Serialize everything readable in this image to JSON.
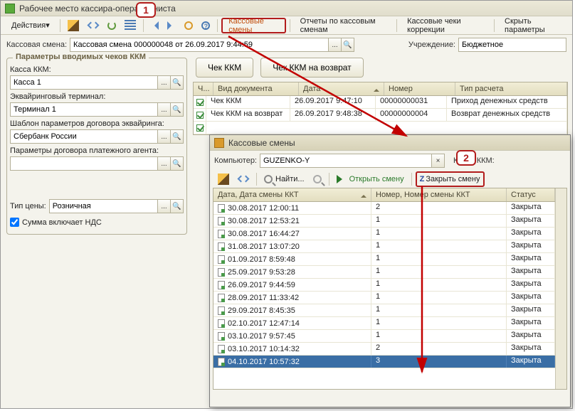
{
  "window": {
    "title": "Рабочее место кассира-операциониста"
  },
  "toolbar": {
    "actions": "Действия",
    "tab_shifts": "Кассовые смены",
    "tab_reports": "Отчеты по кассовым сменам",
    "tab_corrections": "Кассовые чеки коррекции",
    "tab_hide": "Скрыть параметры"
  },
  "shift": {
    "label": "Кассовая смена:",
    "value": "Кассовая смена 000000048 от 26.09.2017 9:44:59",
    "inst_label": "Учреждение:",
    "inst_value": "Бюджетное"
  },
  "group": {
    "legend": "Параметры вводимых чеков ККМ",
    "kassa_label": "Касса ККМ:",
    "kassa_value": "Касса 1",
    "term_label": "Эквайринговый терминал:",
    "term_value": "Терминал 1",
    "tmpl_label": "Шаблон параметров договора эквайринга:",
    "tmpl_value": "Сбербанк России",
    "agent_label": "Параметры договора платежного агента:",
    "agent_value": "",
    "price_label": "Тип цены:",
    "price_value": "Розничная",
    "vat_label": "Сумма включает НДС"
  },
  "buttons": {
    "check": "Чек ККМ",
    "refund": "Чек ККМ на возврат"
  },
  "docs": {
    "headers": {
      "c1": "Ч...",
      "c2": "Вид документа",
      "c3": "Дата",
      "c4": "Номер",
      "c5": "Тип расчета"
    },
    "rows": [
      {
        "kind": "Чек ККМ",
        "date": "26.09.2017 9:47:10",
        "num": "00000000031",
        "type": "Приход денежных средств"
      },
      {
        "kind": "Чек ККМ на возврат",
        "date": "26.09.2017 9:48:38",
        "num": "00000000004",
        "type": "Возврат денежных средств"
      }
    ]
  },
  "popup": {
    "title": "Кассовые смены",
    "comp_label": "Компьютер:",
    "comp_value": "GUZENKO-Y",
    "kassa_label": "Касса ККМ:",
    "find": "Найти...",
    "open": "Открыть смену",
    "close": "Закрыть смену",
    "headers": {
      "c1": "Дата, Дата смены ККТ",
      "c2": "Номер, Номер смены ККТ",
      "c3": "Статус"
    },
    "rows": [
      {
        "date": "30.08.2017 12:00:11",
        "num": "2",
        "status": "Закрыта"
      },
      {
        "date": "30.08.2017 12:53:21",
        "num": "1",
        "status": "Закрыта"
      },
      {
        "date": "30.08.2017 16:44:27",
        "num": "1",
        "status": "Закрыта"
      },
      {
        "date": "31.08.2017 13:07:20",
        "num": "1",
        "status": "Закрыта"
      },
      {
        "date": "01.09.2017 8:59:48",
        "num": "1",
        "status": "Закрыта"
      },
      {
        "date": "25.09.2017 9:53:28",
        "num": "1",
        "status": "Закрыта"
      },
      {
        "date": "26.09.2017 9:44:59",
        "num": "1",
        "status": "Закрыта"
      },
      {
        "date": "28.09.2017 11:33:42",
        "num": "1",
        "status": "Закрыта"
      },
      {
        "date": "29.09.2017 8:45:35",
        "num": "1",
        "status": "Закрыта"
      },
      {
        "date": "02.10.2017 12:47:14",
        "num": "1",
        "status": "Закрыта"
      },
      {
        "date": "03.10.2017 9:57:45",
        "num": "1",
        "status": "Закрыта"
      },
      {
        "date": "03.10.2017 10:14:32",
        "num": "2",
        "status": "Закрыта"
      },
      {
        "date": "04.10.2017 10:57:32",
        "num": "3",
        "status": "Закрыта"
      }
    ],
    "selected": 12
  },
  "callouts": {
    "one": "1",
    "two": "2"
  }
}
